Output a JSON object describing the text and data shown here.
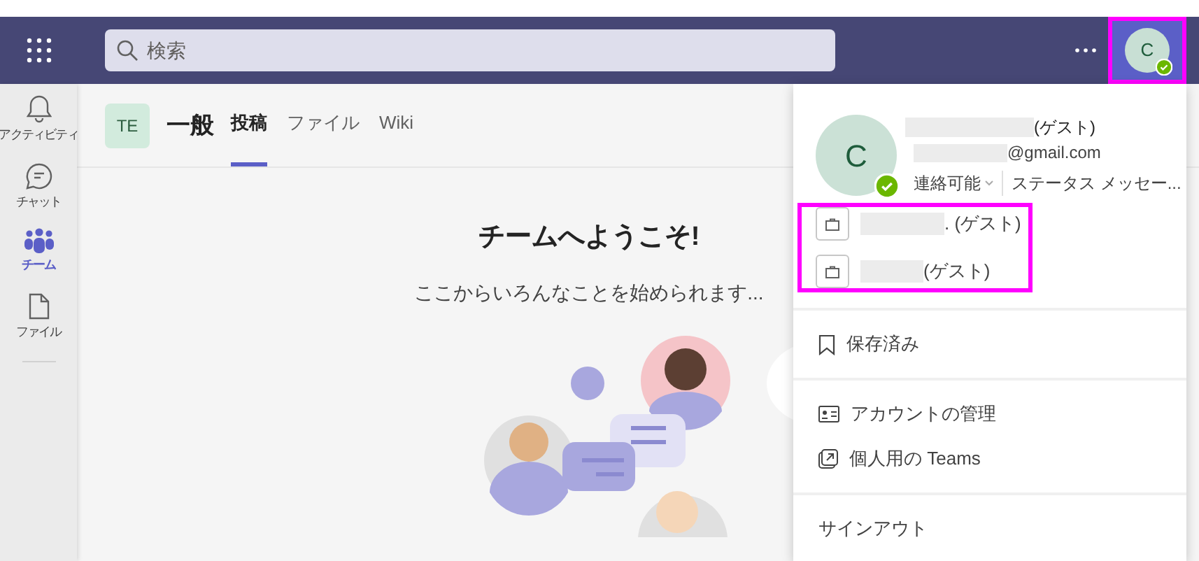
{
  "search": {
    "placeholder": "検索"
  },
  "avatar": {
    "initial": "C",
    "available": true
  },
  "rail": [
    {
      "label": "アクティビティ",
      "kind": "bell",
      "selected": false
    },
    {
      "label": "チャット",
      "kind": "chat",
      "selected": false
    },
    {
      "label": "チーム",
      "kind": "teams",
      "selected": true
    },
    {
      "label": "ファイル",
      "kind": "file",
      "selected": false
    }
  ],
  "channel": {
    "team_badge": "TE",
    "name": "一般",
    "tabs": [
      {
        "label": "投稿",
        "selected": true
      },
      {
        "label": "ファイル",
        "selected": false
      },
      {
        "label": "Wiki",
        "selected": false
      }
    ]
  },
  "welcome": {
    "title": "チームへようこそ!",
    "subtitle": "ここからいろんなことを始められます..."
  },
  "profile_menu": {
    "initial": "C",
    "available": true,
    "name_suffix": "(ゲスト)",
    "email_suffix": "@gmail.com",
    "status_label": "連絡可能",
    "status_message": "ステータス メッセー...",
    "organizations": [
      {
        "name_suffix": ". (ゲスト)"
      },
      {
        "name_suffix": "(ゲスト)"
      }
    ],
    "sections": [
      [
        {
          "label": "保存済み",
          "kind": "bookmark"
        }
      ],
      [
        {
          "label": "アカウントの管理",
          "kind": "account"
        },
        {
          "label": "個人用の Teams",
          "kind": "external"
        }
      ],
      [
        {
          "label": "サインアウト",
          "kind": "plain"
        }
      ]
    ]
  }
}
